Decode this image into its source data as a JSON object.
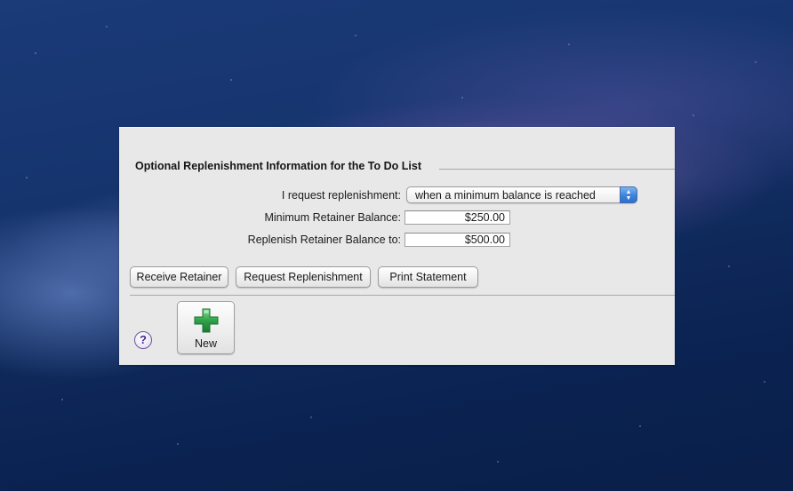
{
  "section": {
    "title": "Optional Replenishment Information for the To Do List"
  },
  "form": {
    "replenishment_label": "I request replenishment:",
    "replenishment_value": "when a minimum balance is reached",
    "min_balance_label": "Minimum Retainer Balance:",
    "min_balance_value": "$250.00",
    "replenish_to_label": "Replenish Retainer Balance to:",
    "replenish_to_value": "$500.00"
  },
  "buttons": {
    "receive_retainer": "Receive Retainer",
    "request_replenishment": "Request Replenishment",
    "print_statement": "Print Statement"
  },
  "toolbar": {
    "help_glyph": "?",
    "new_label": "New"
  },
  "icons": {
    "popup_arrows": "up-down-arrows-icon",
    "help": "help-icon",
    "new": "green-plus-icon"
  },
  "colors": {
    "popup_accent": "#3c82db",
    "plus_green": "#2fa24a",
    "help_purple": "#3e2a86"
  }
}
